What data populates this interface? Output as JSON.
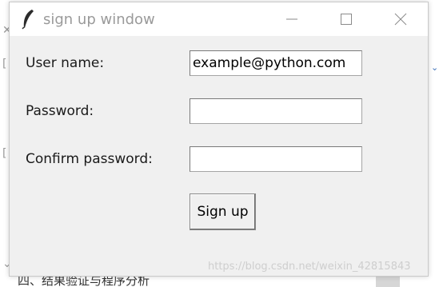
{
  "window": {
    "title": "sign up window",
    "icon": "feather-icon",
    "controls": [
      "minimize-icon",
      "maximize-icon",
      "close-icon"
    ]
  },
  "form": {
    "username_label": "User name:",
    "username_value": "example@python.com",
    "password_label": "Password:",
    "password_value": "",
    "confirm_label": "Confirm password:",
    "confirm_value": "",
    "submit_label": "Sign up"
  },
  "background": {
    "bottom_text": "四、结果验证与程序分析"
  },
  "watermark": "https://blog.csdn.net/weixin_42815843",
  "colors": {
    "window_bg": "#f0f0f0",
    "titlebar_bg": "#ffffff",
    "title_text": "#9a9a9a"
  }
}
